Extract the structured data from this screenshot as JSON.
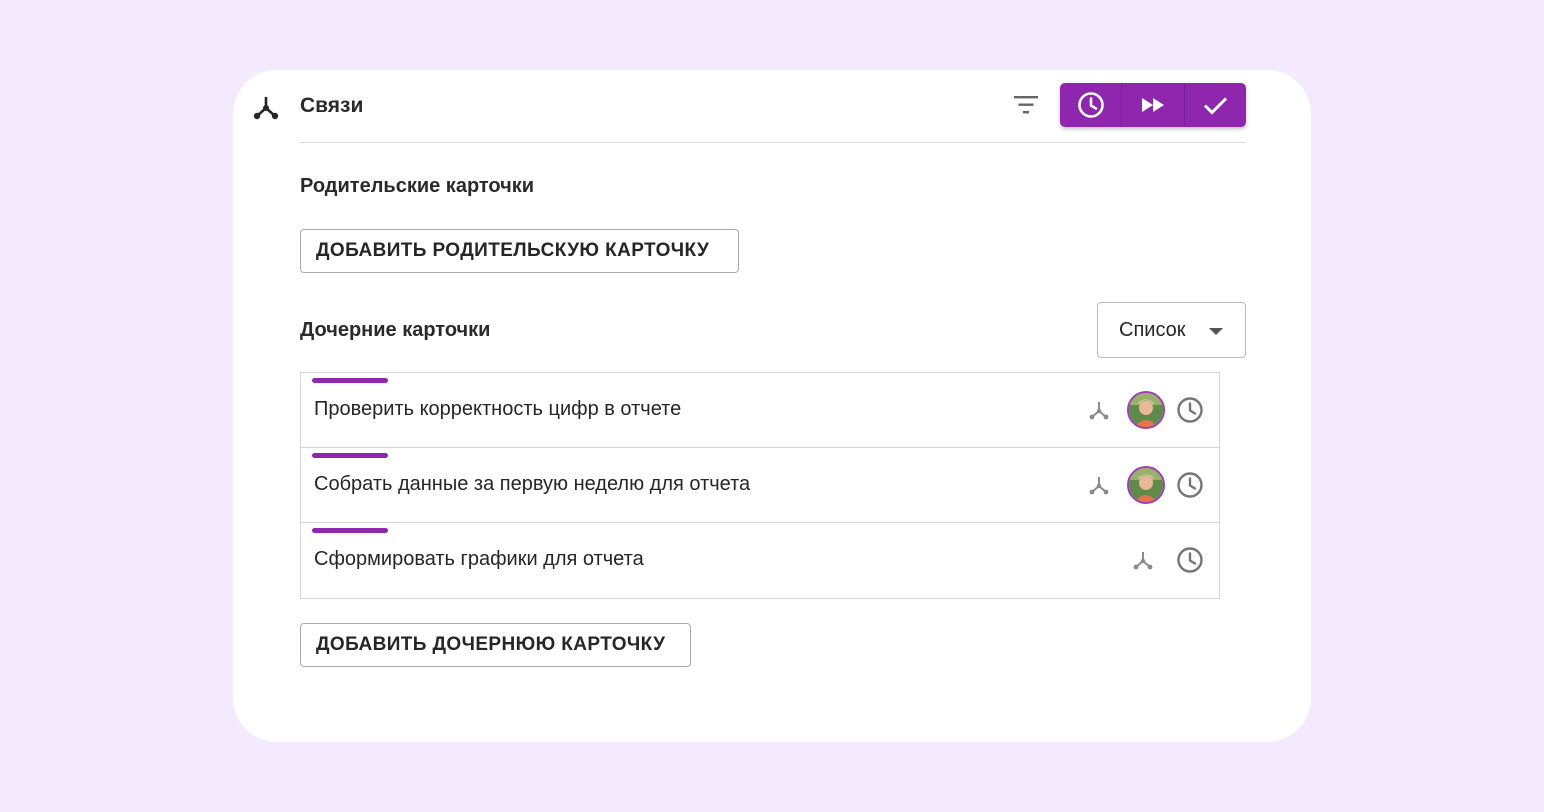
{
  "header": {
    "title": "Связи",
    "icon": "hierarchy-icon",
    "filter_icon": "filter-icon",
    "actions": [
      {
        "name": "clock-button",
        "icon": "clock-icon"
      },
      {
        "name": "fast-forward-button",
        "icon": "fast-forward-icon"
      },
      {
        "name": "check-button",
        "icon": "check-icon"
      }
    ]
  },
  "parent": {
    "title": "Родительские карточки",
    "add_label": "ДОБАВИТЬ РОДИТЕЛЬСКУЮ КАРТОЧКУ"
  },
  "children": {
    "title": "Дочерние карточки",
    "view_select": "Список",
    "items": [
      {
        "title": "Проверить корректность цифр в отчете",
        "has_avatar": true
      },
      {
        "title": "Собрать данные за первую неделю для отчета",
        "has_avatar": true
      },
      {
        "title": "Сформировать графики для отчета",
        "has_avatar": false
      }
    ],
    "add_label": "ДОБАВИТЬ ДОЧЕРНЮЮ КАРТОЧКУ"
  },
  "colors": {
    "accent": "#8e27ae",
    "background": "#f4eafd",
    "card": "#ffffff"
  }
}
